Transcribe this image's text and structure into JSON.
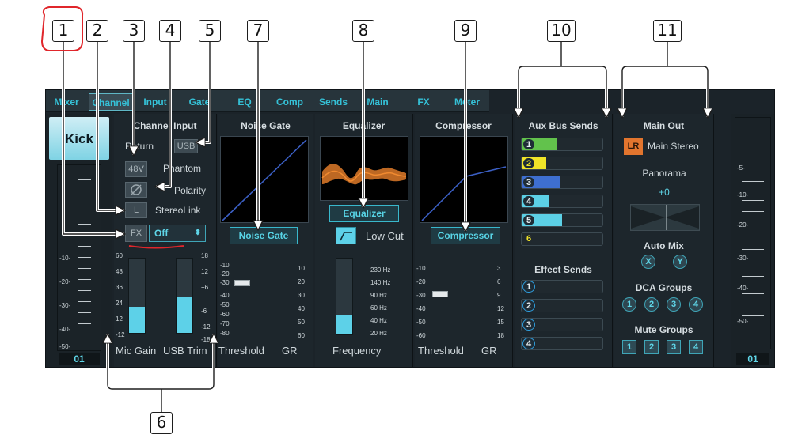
{
  "tabs": [
    "Mixer",
    "Channel",
    "Input",
    "Gate",
    "EQ",
    "Comp",
    "Sends",
    "Main",
    "FX",
    "Meter"
  ],
  "active_tab": "Channel",
  "channel_name": "Kick",
  "channel_number": "01",
  "right_channel_number": "01",
  "channel_input": {
    "title": "Channel Input",
    "return_label": "Return",
    "usb_button": "USB",
    "phantom_button": "48V",
    "phantom_label": "Phantom",
    "polarity_label": "Polarity",
    "stereolink_button": "L",
    "stereolink_label": "StereoLink",
    "fx_button": "FX",
    "fx_select_value": "Off",
    "gain_scale": [
      "60",
      "48",
      "36",
      "24",
      "12",
      "-12"
    ],
    "trim_scale": [
      "18",
      "12",
      "+6",
      "-6",
      "-12",
      "-18"
    ],
    "mic_gain_label": "Mic Gain",
    "usb_trim_label": "USB Trim",
    "mic_gain_level": 0.35,
    "usb_trim_level": 0.48
  },
  "noise_gate": {
    "title": "Noise Gate",
    "button": "Noise Gate",
    "threshold_scale": [
      "-10",
      "-20",
      "-30",
      "-40",
      "-50",
      "-60",
      "-70",
      "-80"
    ],
    "gr_scale": [
      "10",
      "20",
      "30",
      "40",
      "50",
      "60"
    ],
    "threshold_label": "Threshold",
    "gr_label": "GR"
  },
  "equalizer": {
    "title": "Equalizer",
    "button": "Equalizer",
    "lowcut_label": "Low Cut",
    "freq_scale": [
      "230 Hz",
      "140 Hz",
      "90 Hz",
      "60 Hz",
      "40 Hz",
      "20 Hz"
    ],
    "frequency_label": "Frequency",
    "lowcut_level": 0.25
  },
  "compressor": {
    "title": "Compressor",
    "button": "Compressor",
    "threshold_scale": [
      "-10",
      "-20",
      "-30",
      "-40",
      "-50",
      "-60"
    ],
    "gr_scale": [
      "3",
      "6",
      "9",
      "12",
      "15",
      "18"
    ],
    "threshold_label": "Threshold",
    "gr_label": "GR"
  },
  "aux_sends": {
    "title": "Aux Bus Sends",
    "buses": [
      {
        "num": "1",
        "level": 0.44,
        "color": "#62c24c"
      },
      {
        "num": "2",
        "level": 0.3,
        "color": "#f0e428"
      },
      {
        "num": "3",
        "level": 0.48,
        "color": "#3e6fd0"
      },
      {
        "num": "4",
        "level": 0.34,
        "color": "#5cd0e6"
      },
      {
        "num": "5",
        "level": 0.5,
        "color": "#5cd0e6"
      },
      {
        "num": "6",
        "level": 0.0,
        "color": "#5cd0e6"
      }
    ],
    "effect_title": "Effect Sends",
    "effects": [
      "1",
      "2",
      "3",
      "4"
    ]
  },
  "main_out": {
    "title": "Main Out",
    "lr_button": "LR",
    "main_label": "Main Stereo",
    "panorama_label": "Panorama",
    "panorama_value": "+0",
    "automix_title": "Auto Mix",
    "automix": [
      "X",
      "Y"
    ],
    "dca_title": "DCA Groups",
    "dca": [
      "1",
      "2",
      "3",
      "4"
    ],
    "mute_title": "Mute Groups",
    "mute": [
      "1",
      "2",
      "3",
      "4"
    ]
  },
  "left_meter_scale": [
    "-10-",
    "-20-",
    "-30-",
    "-40-",
    "-50-"
  ],
  "right_meter_scale": [
    "-5-",
    "-10-",
    "-20-",
    "-30-",
    "-40-",
    "-50-"
  ],
  "callouts": [
    "1",
    "2",
    "3",
    "4",
    "5",
    "7",
    "8",
    "9",
    "10",
    "11",
    "6"
  ],
  "colors": {
    "accent": "#35c2d8",
    "highlight_circle": "#e0262b",
    "underline": "#e0262b",
    "lr_button": "#e2752e"
  }
}
